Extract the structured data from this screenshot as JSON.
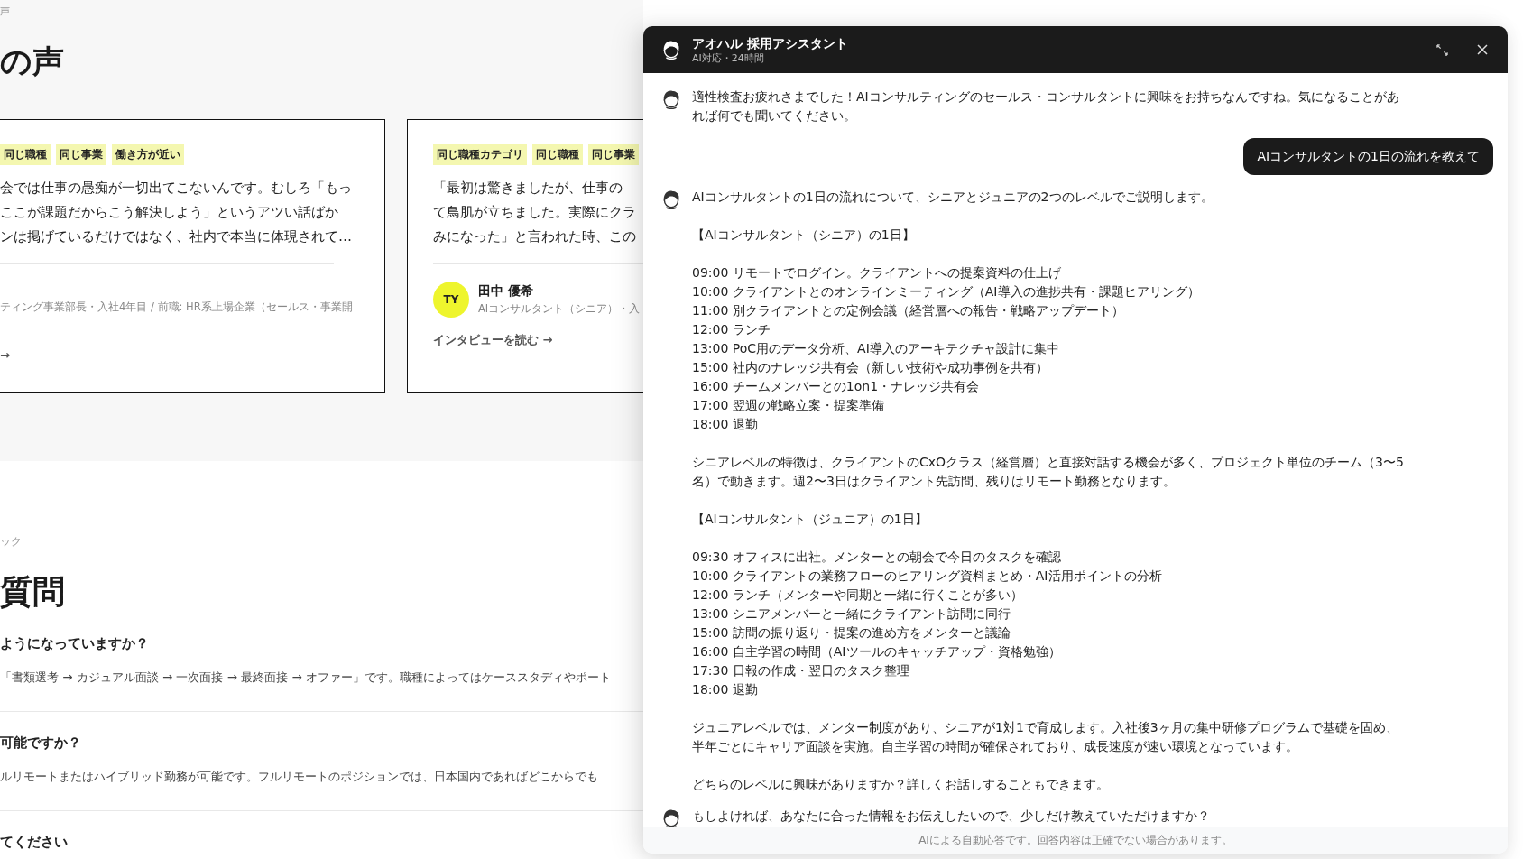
{
  "page": {
    "breadcrumb": "声",
    "heading": "の声",
    "cards": [
      {
        "tags": [
          "同じ職種",
          "同じ事業",
          "働き方が近い"
        ],
        "quote_lines": [
          "会では仕事の愚痴が一切出てこないんです。むしろ「もっ",
          "ここが課題だからこう解決しよう」というアツい話ばか",
          "ンは掲げているだけではなく、社内で本当に体現されて…"
        ],
        "role": "ティング事業部長・入社4年目 / 前職: HR系上場企業（セールス・事業開",
        "link": "→"
      },
      {
        "tags": [
          "同じ職種カテゴリ",
          "同じ職種",
          "同じ事業"
        ],
        "quote_lines": [
          "「最初は驚きましたが、仕事の",
          "て鳥肌が立ちました。実際にクラ",
          "みになった」と言われた時、この"
        ],
        "avatar_initials": "TY",
        "name": "田中 優希",
        "role": "AIコンサルタント（シニア）・入",
        "link": "インタビューを読む →"
      }
    ]
  },
  "faq": {
    "eyebrow": "ック",
    "heading": "質問",
    "items": [
      {
        "question": "ようになっていますか？",
        "answer": "「書類選考 → カジュアル面談 → 一次面接 → 最終面接 → オファー」です。職種によってはケーススタディやポート"
      },
      {
        "question": "可能ですか？",
        "answer": "ルリモートまたはハイブリッド勤務が可能です。フルリモートのポジションでは、日本国内であればどこからでも"
      },
      {
        "question": "てください"
      }
    ]
  },
  "chat": {
    "title": "アオハル 採用アシスタント",
    "subtitle": "AI対応・24時間",
    "messages": [
      {
        "kind": "bot",
        "paragraphs": [
          "適性検査お疲れさまでした！AIコンサルティングのセールス・コンサルタントに興味をお持ちなんですね。気になることがあれば何でも聞いてください。"
        ]
      },
      {
        "kind": "user",
        "paragraphs": [
          "AIコンサルタントの1日の流れを教えて"
        ]
      },
      {
        "kind": "bot",
        "paragraphs": [
          "AIコンサルタントの1日の流れについて、シニアとジュニアの2つのレベルでご説明します。",
          "【AIコンサルタント（シニア）の1日】",
          "09:00 リモートでログイン。クライアントへの提案資料の仕上げ\n10:00 クライアントとのオンラインミーティング（AI導入の進捗共有・課題ヒアリング）\n11:00 別クライアントとの定例会議（経営層への報告・戦略アップデート）\n12:00 ランチ\n13:00 PoC用のデータ分析、AI導入のアーキテクチャ設計に集中\n15:00 社内のナレッジ共有会（新しい技術や成功事例を共有）\n16:00 チームメンバーとの1on1・ナレッジ共有会\n17:00 翌週の戦略立案・提案準備\n18:00 退勤",
          "シニアレベルの特徴は、クライアントのCxOクラス（経営層）と直接対話する機会が多く、プロジェクト単位のチーム（3〜5名）で動きます。週2〜3日はクライアント先訪問、残りはリモート勤務となります。",
          "【AIコンサルタント（ジュニア）の1日】",
          "09:30 オフィスに出社。メンターとの朝会で今日のタスクを確認\n10:00 クライアントの業務フローのヒアリング資料まとめ・AI活用ポイントの分析\n12:00 ランチ（メンターや同期と一緒に行くことが多い）\n13:00 シニアメンバーと一緒にクライアント訪問に同行\n15:00 訪問の振り返り・提案の進め方をメンターと議論\n16:00 自主学習の時間（AIツールのキャッチアップ・資格勉強）\n17:30 日報の作成・翌日のタスク整理\n18:00 退勤",
          "ジュニアレベルでは、メンター制度があり、シニアが1対1で育成します。入社後3ヶ月の集中研修プログラムで基礎を固め、半年ごとにキャリア面談を実施。自主学習の時間が確保されており、成長速度が速い環境となっています。",
          "どちらのレベルに興味がありますか？詳しくお話しすることもできます。"
        ]
      },
      {
        "kind": "bot",
        "paragraphs": [
          "もしよければ、あなたに合った情報をお伝えしたいので、少しだけ教えていただけますか？"
        ]
      }
    ],
    "footer": "AIによる自動応答です。回答内容は正確でない場合があります。"
  }
}
